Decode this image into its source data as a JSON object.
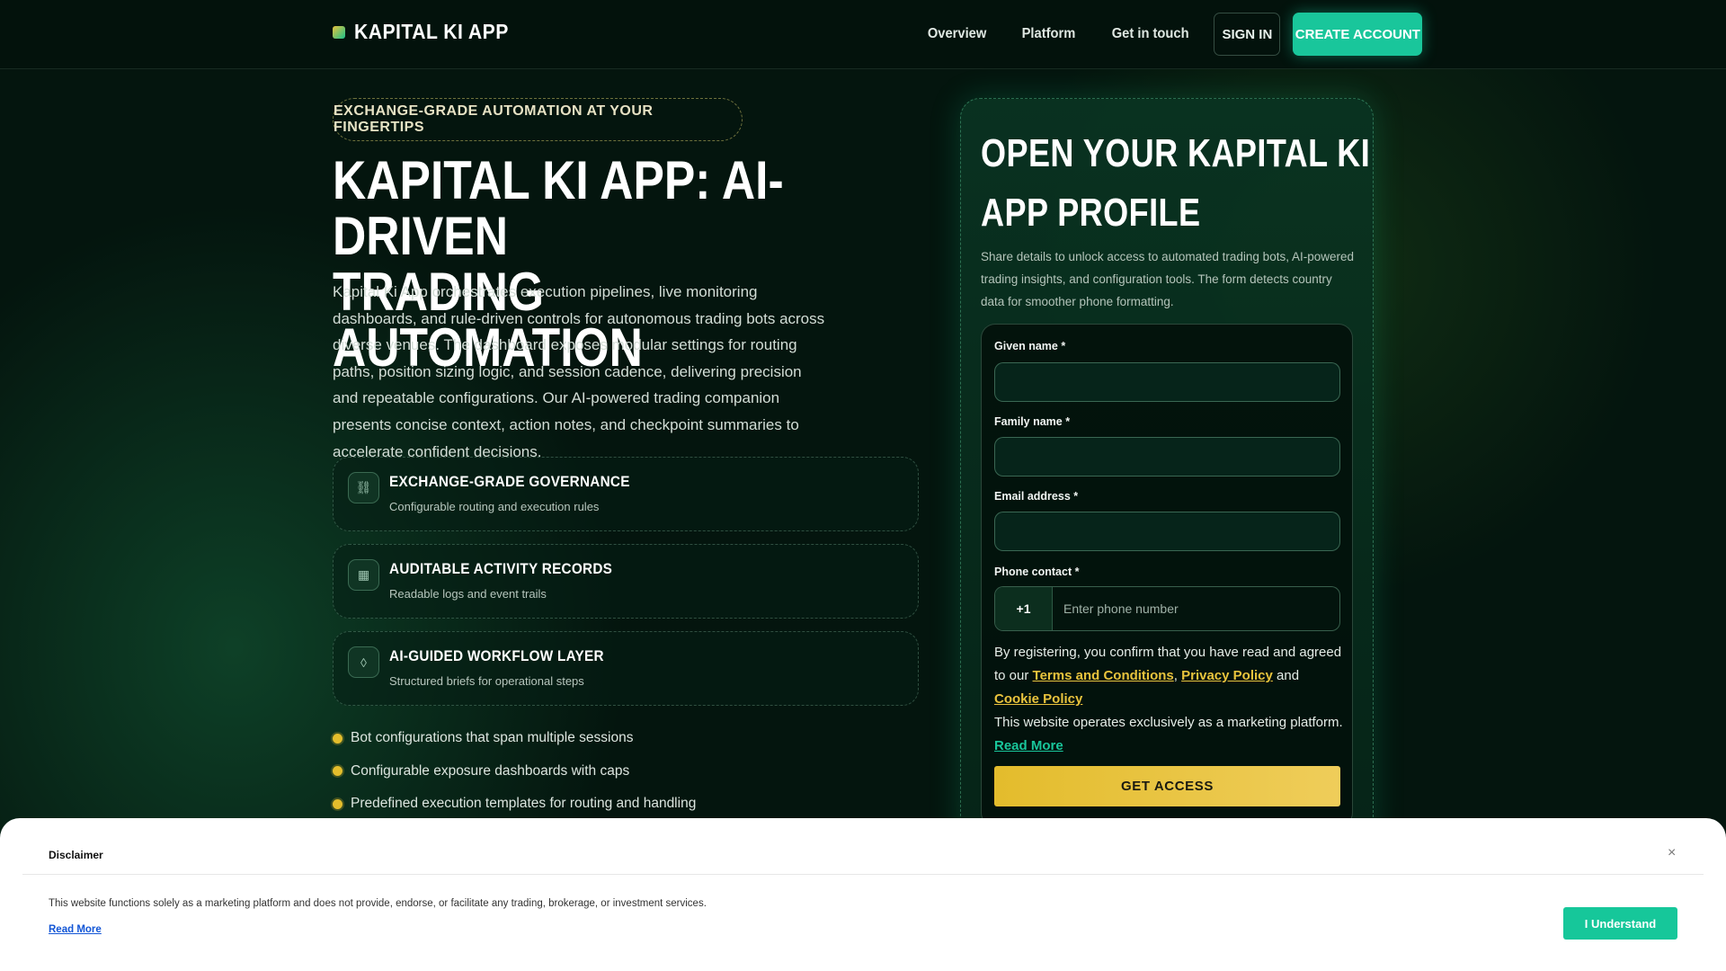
{
  "header": {
    "brand": "KAPITAL KI APP",
    "nav": [
      "Overview",
      "Platform",
      "Get in touch"
    ],
    "sign_in": "SIGN IN",
    "create_account": "CREATE ACCOUNT"
  },
  "hero": {
    "pill": "EXCHANGE-GRADE AUTOMATION AT YOUR FINGERTIPS",
    "title_line1": "KAPITAL KI APP: AI-DRIVEN",
    "title_line2": "TRADING AUTOMATION",
    "description": "Kapital Ki App orchestrates execution pipelines, live monitoring dashboards, and rule-driven controls for autonomous trading bots across diverse venues. The dashboard exposes modular settings for routing paths, position sizing logic, and session cadence, delivering precision and repeatable configurations. Our AI-powered trading companion presents concise context, action notes, and checkpoint summaries to accelerate confident decisions."
  },
  "features": [
    {
      "icon": "link-icon",
      "glyph": "⛓",
      "title": "EXCHANGE-GRADE GOVERNANCE",
      "subtitle": "Configurable routing and execution rules"
    },
    {
      "icon": "records-icon",
      "glyph": "▦",
      "title": "AUDITABLE ACTIVITY RECORDS",
      "subtitle": "Readable logs and event trails"
    },
    {
      "icon": "diamond-icon",
      "glyph": "◊",
      "title": "AI-GUIDED WORKFLOW LAYER",
      "subtitle": "Structured briefs for operational steps"
    }
  ],
  "bullets": [
    "Bot configurations that span multiple sessions",
    "Configurable exposure dashboards with caps",
    "Predefined execution templates for routing and handling"
  ],
  "panel": {
    "title_line1": "OPEN YOUR KAPITAL KI",
    "title_line2": "APP PROFILE",
    "description": "Share details to unlock access to automated trading bots, AI-powered trading insights, and configuration tools. The form detects country data for smoother phone formatting.",
    "form": {
      "given_name_label": "Given name *",
      "given_name_value": "",
      "family_name_label": "Family name *",
      "family_name_value": "",
      "email_label": "Email address *",
      "email_value": "",
      "phone_label": "Phone contact *",
      "phone_code": "+1",
      "phone_placeholder": "Enter phone number",
      "consent_prefix": "By registering, you confirm that you have read and agreed to our",
      "terms": "Terms and Conditions",
      "comma": ",",
      "privacy": "Privacy Policy",
      "and": "and",
      "cookie": "Cookie Policy",
      "marketing_note": "This website operates exclusively as a marketing platform.",
      "read_more": "Read More",
      "submit": "GET ACCESS"
    }
  },
  "disclaimer": {
    "title": "Disclaimer",
    "close": "×",
    "text": "This website functions solely as a marketing platform and does not provide, endorse, or facilitate any trading, brokerage, or investment services.",
    "read_more": "Read More",
    "button": "I Understand"
  },
  "colors": {
    "background": "#04150e",
    "accent_teal": "#19c69b",
    "accent_gold": "#e3bc2c"
  }
}
